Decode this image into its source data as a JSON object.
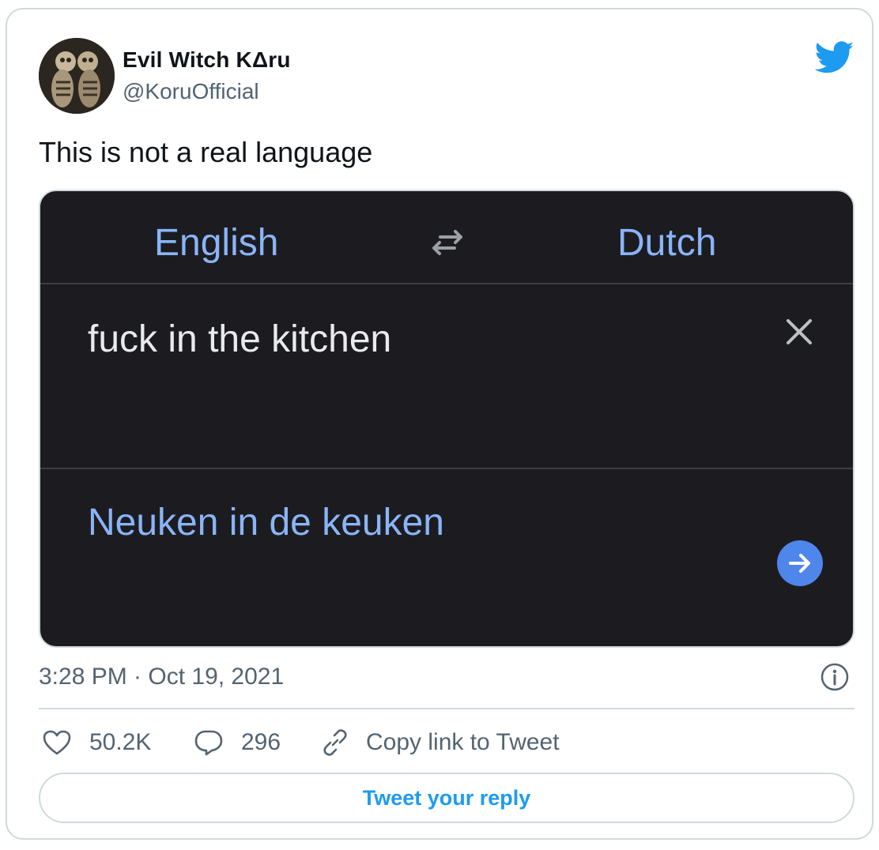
{
  "author": {
    "display_name": "Evil Witch KΔru",
    "handle": "@KoruOfficial"
  },
  "tweet": {
    "text": "This is not a real language",
    "timestamp": "3:28 PM · Oct 19, 2021"
  },
  "media": {
    "source_language": "English",
    "target_language": "Dutch",
    "source_text": "fuck in the kitchen",
    "translated_text": "Neuken in de keuken"
  },
  "actions": {
    "likes": "50.2K",
    "replies": "296",
    "copy_link_label": "Copy link to Tweet"
  },
  "reply_button_label": "Tweet your reply",
  "colors": {
    "twitter_blue": "#1d9bf0",
    "translate_blue": "#8ab4f8",
    "media_background": "#1c1c20",
    "muted_text": "#536471"
  },
  "icons": [
    "avatar-image",
    "twitter-bird-icon",
    "swap-languages-icon",
    "close-icon",
    "arrow-right-icon",
    "info-icon",
    "heart-icon",
    "reply-bubble-icon",
    "link-icon"
  ]
}
